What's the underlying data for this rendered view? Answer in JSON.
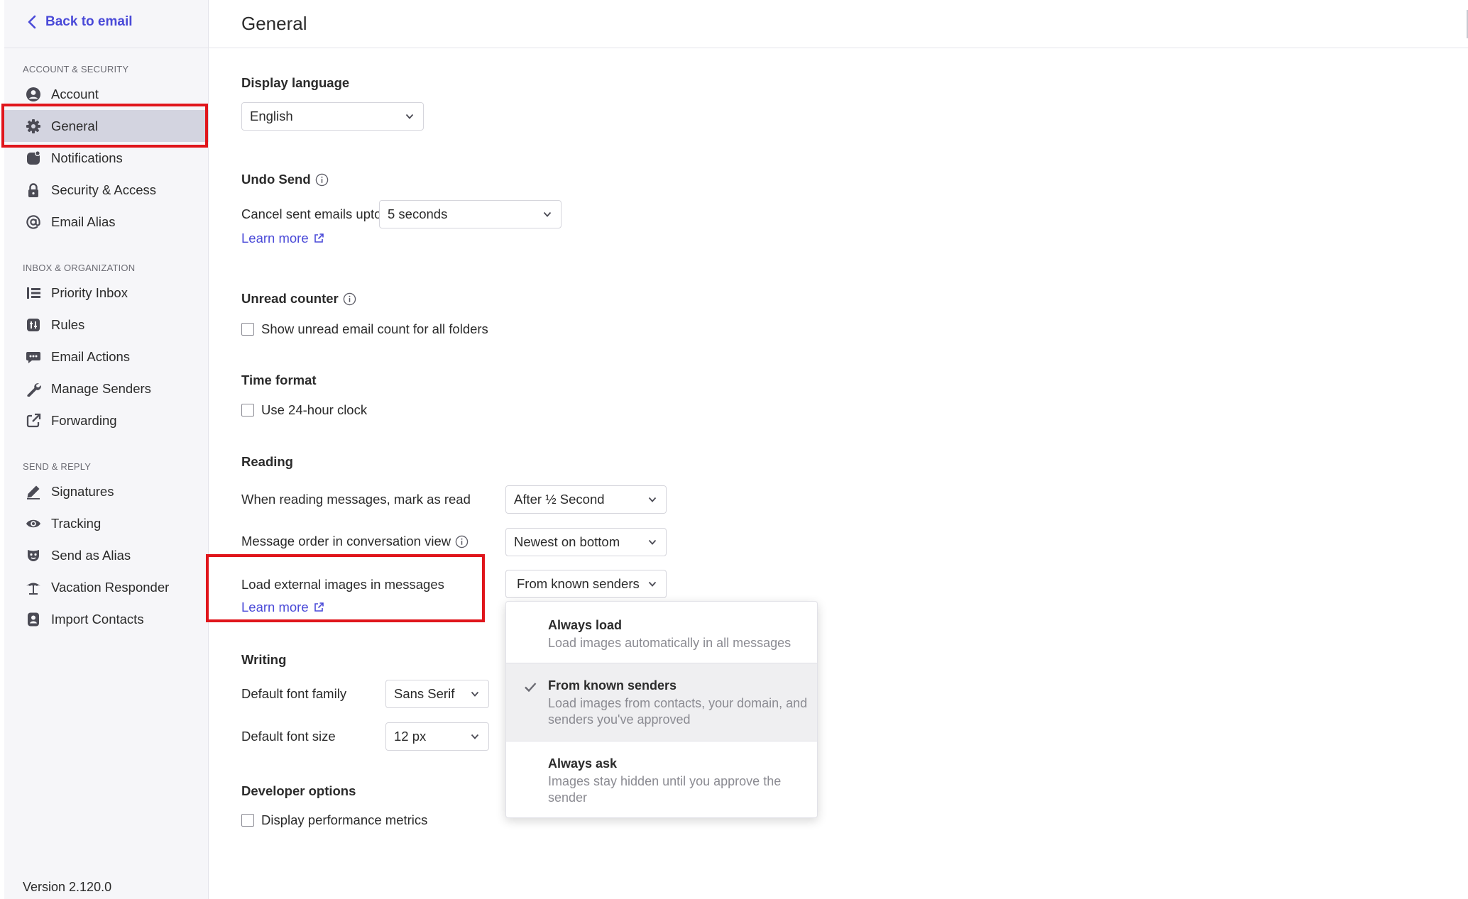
{
  "sidebar": {
    "back_label": "Back to email",
    "sections": [
      {
        "title": "ACCOUNT & SECURITY",
        "items": [
          {
            "label": "Account",
            "icon": "account-circle-icon"
          },
          {
            "label": "General",
            "icon": "gear-icon",
            "active": true
          },
          {
            "label": "Notifications",
            "icon": "notification-icon"
          },
          {
            "label": "Security & Access",
            "icon": "lock-icon"
          },
          {
            "label": "Email Alias",
            "icon": "at-sign-icon"
          }
        ]
      },
      {
        "title": "INBOX & ORGANIZATION",
        "items": [
          {
            "label": "Priority Inbox",
            "icon": "priority-list-icon"
          },
          {
            "label": "Rules",
            "icon": "rules-icon"
          },
          {
            "label": "Email Actions",
            "icon": "email-actions-icon"
          },
          {
            "label": "Manage Senders",
            "icon": "wrench-icon"
          },
          {
            "label": "Forwarding",
            "icon": "forward-icon"
          }
        ]
      },
      {
        "title": "SEND & REPLY",
        "items": [
          {
            "label": "Signatures",
            "icon": "pen-icon"
          },
          {
            "label": "Tracking",
            "icon": "eye-icon"
          },
          {
            "label": "Send as Alias",
            "icon": "mask-icon"
          },
          {
            "label": "Vacation Responder",
            "icon": "umbrella-icon"
          },
          {
            "label": "Import Contacts",
            "icon": "contact-icon"
          }
        ]
      }
    ],
    "version": "Version 2.120.0"
  },
  "header": {
    "title": "General"
  },
  "display_language": {
    "title": "Display language",
    "value": "English"
  },
  "undo_send": {
    "title": "Undo Send",
    "label": "Cancel sent emails upto",
    "value": "5 seconds",
    "learn_more": "Learn more"
  },
  "unread_counter": {
    "title": "Unread counter",
    "checkbox_label": "Show unread email count for all folders",
    "checked": false
  },
  "time_format": {
    "title": "Time format",
    "checkbox_label": "Use 24-hour clock",
    "checked": false
  },
  "reading": {
    "title": "Reading",
    "mark_read_label": "When reading messages, mark as read",
    "mark_read_value": "After ½ Second",
    "order_label": "Message order in conversation view",
    "order_value": "Newest on bottom",
    "images_label": "Load external images in messages",
    "images_value": "From known senders",
    "images_learn_more": "Learn more"
  },
  "writing": {
    "title": "Writing",
    "font_family_label": "Default font family",
    "font_family_value": "Sans Serif",
    "font_size_label": "Default font size",
    "font_size_value": "12 px"
  },
  "developer": {
    "title": "Developer options",
    "checkbox_label": "Display performance metrics",
    "checked": false
  },
  "images_menu": {
    "options": [
      {
        "title": "Always load",
        "desc": "Load images automatically in all messages",
        "selected": false
      },
      {
        "title": "From known senders",
        "desc": "Load images from contacts, your domain, and senders you've approved",
        "selected": true
      },
      {
        "title": "Always ask",
        "desc": "Images stay hidden until you approve the sender",
        "selected": false
      }
    ]
  },
  "colors": {
    "accent": "#4a4ad8",
    "highlight": "#e0151b",
    "active_bg": "#d3d4e0"
  }
}
